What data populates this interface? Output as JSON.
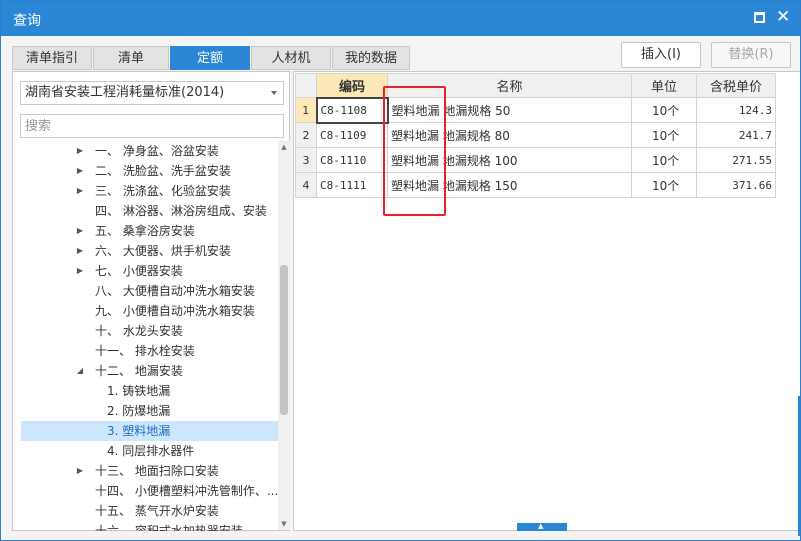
{
  "window": {
    "title": "查询"
  },
  "tabs": [
    {
      "label": "清单指引",
      "active": false
    },
    {
      "label": "清单",
      "active": false
    },
    {
      "label": "定额",
      "active": true
    },
    {
      "label": "人材机",
      "active": false
    },
    {
      "label": "我的数据",
      "active": false
    }
  ],
  "toolbar": {
    "insert_label": "插入(I)",
    "replace_label": "替换(R)"
  },
  "left": {
    "standard_select": "湖南省安装工程消耗量标准(2014)",
    "search_placeholder": "搜索",
    "tree": [
      {
        "label": "一、 净身盆、浴盆安装",
        "expandable": true
      },
      {
        "label": "二、 洗脸盆、洗手盆安装",
        "expandable": true
      },
      {
        "label": "三、 洗涤盆、化验盆安装",
        "expandable": true
      },
      {
        "label": "四、 淋浴器、淋浴房组成、安装",
        "expandable": false
      },
      {
        "label": "五、 桑拿浴房安装",
        "expandable": true
      },
      {
        "label": "六、 大便器、烘手机安装",
        "expandable": true
      },
      {
        "label": "七、 小便器安装",
        "expandable": true
      },
      {
        "label": "八、 大便槽自动冲洗水箱安装",
        "expandable": false
      },
      {
        "label": "九、 小便槽自动冲洗水箱安装",
        "expandable": false
      },
      {
        "label": "十、 水龙头安装",
        "expandable": false
      },
      {
        "label": "十一、 排水栓安装",
        "expandable": false
      },
      {
        "label": "十二、 地漏安装",
        "expandable": true,
        "expanded": true
      },
      {
        "label": "1. 铸铁地漏",
        "child": true
      },
      {
        "label": "2. 防爆地漏",
        "child": true
      },
      {
        "label": "3. 塑料地漏",
        "child": true,
        "selected": true
      },
      {
        "label": "4. 同层排水器件",
        "child": true
      },
      {
        "label": "十三、 地面扫除口安装",
        "expandable": true
      },
      {
        "label": "十四、 小便槽塑料冲洗管制作、...",
        "expandable": false
      },
      {
        "label": "十五、 蒸气开水炉安装",
        "expandable": false
      },
      {
        "label": "十六、 容积式水加热器安装",
        "expandable": false
      }
    ]
  },
  "grid": {
    "headers": {
      "code": "编码",
      "name": "名称",
      "unit": "单位",
      "price": "含税单价"
    },
    "rows": [
      {
        "num": "1",
        "code": "C8-1108",
        "name": "塑料地漏  地漏规格  50",
        "unit": "10个",
        "price": "124.3"
      },
      {
        "num": "2",
        "code": "C8-1109",
        "name": "塑料地漏  地漏规格  80",
        "unit": "10个",
        "price": "241.7"
      },
      {
        "num": "3",
        "code": "C8-1110",
        "name": "塑料地漏  地漏规格  100",
        "unit": "10个",
        "price": "271.55"
      },
      {
        "num": "4",
        "code": "C8-1111",
        "name": "塑料地漏  地漏规格  150",
        "unit": "10个",
        "price": "371.66"
      }
    ]
  },
  "colors": {
    "accent": "#2b86d6",
    "highlight": "#e8202a",
    "selected_bg": "#cde6fb",
    "sorted_header": "#fde9b8"
  },
  "icons": {
    "maximize": "maximize-icon",
    "close": "close-icon"
  }
}
